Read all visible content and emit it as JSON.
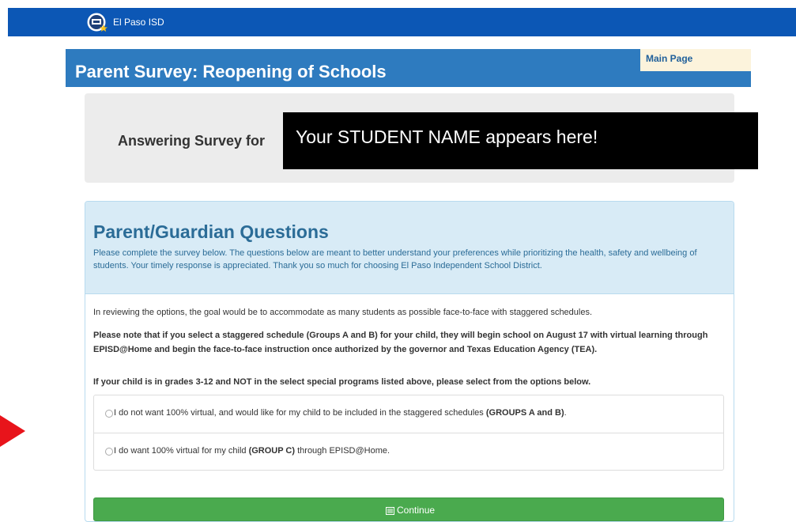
{
  "header": {
    "brand": "El Paso ISD",
    "logo_icon": "el-paso-isd-logo-icon",
    "background_color": "#0c57b5"
  },
  "page": {
    "title": "Parent Survey: Reopening of Schools",
    "main_page_link": "Main Page"
  },
  "student": {
    "label": "Answering Survey for",
    "placeholder_text": "Your STUDENT NAME appears here!"
  },
  "questions": {
    "heading": "Parent/Guardian Questions",
    "intro": "Please complete the survey below. The questions below are meant to better understand your preferences while prioritizing the health, safety and wellbeing of students. Your timely response is appreciated. Thank you so much for choosing El Paso Independent School District.",
    "paragraph1": "In reviewing the options, the goal would be to accommodate as many students as possible face-to-face with staggered schedules.",
    "paragraph2": "Please note that if you select a staggered schedule (Groups A and B) for your child, they will begin school on August 17 with virtual learning through EPISD@Home and begin the face-to-face instruction once authorized by the governor and Texas Education Agency (TEA).",
    "paragraph3": "If your child is in grades 3-12 and NOT in the select special programs listed above, please select from the options below.",
    "options": [
      {
        "before": "I do not want 100% virtual, and would like for my child to be included in the staggered schedules ",
        "bold": "(GROUPS A and B)",
        "after": ".",
        "selected": false
      },
      {
        "before": "I do want 100% virtual for my child ",
        "bold": "(GROUP C)",
        "after": " through EPISD@Home.",
        "selected": false
      }
    ],
    "continue_label": "Continue",
    "continue_icon": "list-icon"
  },
  "annotation": {
    "arrow_icon": "red-arrow-icon",
    "arrow_color": "#e8141b"
  }
}
